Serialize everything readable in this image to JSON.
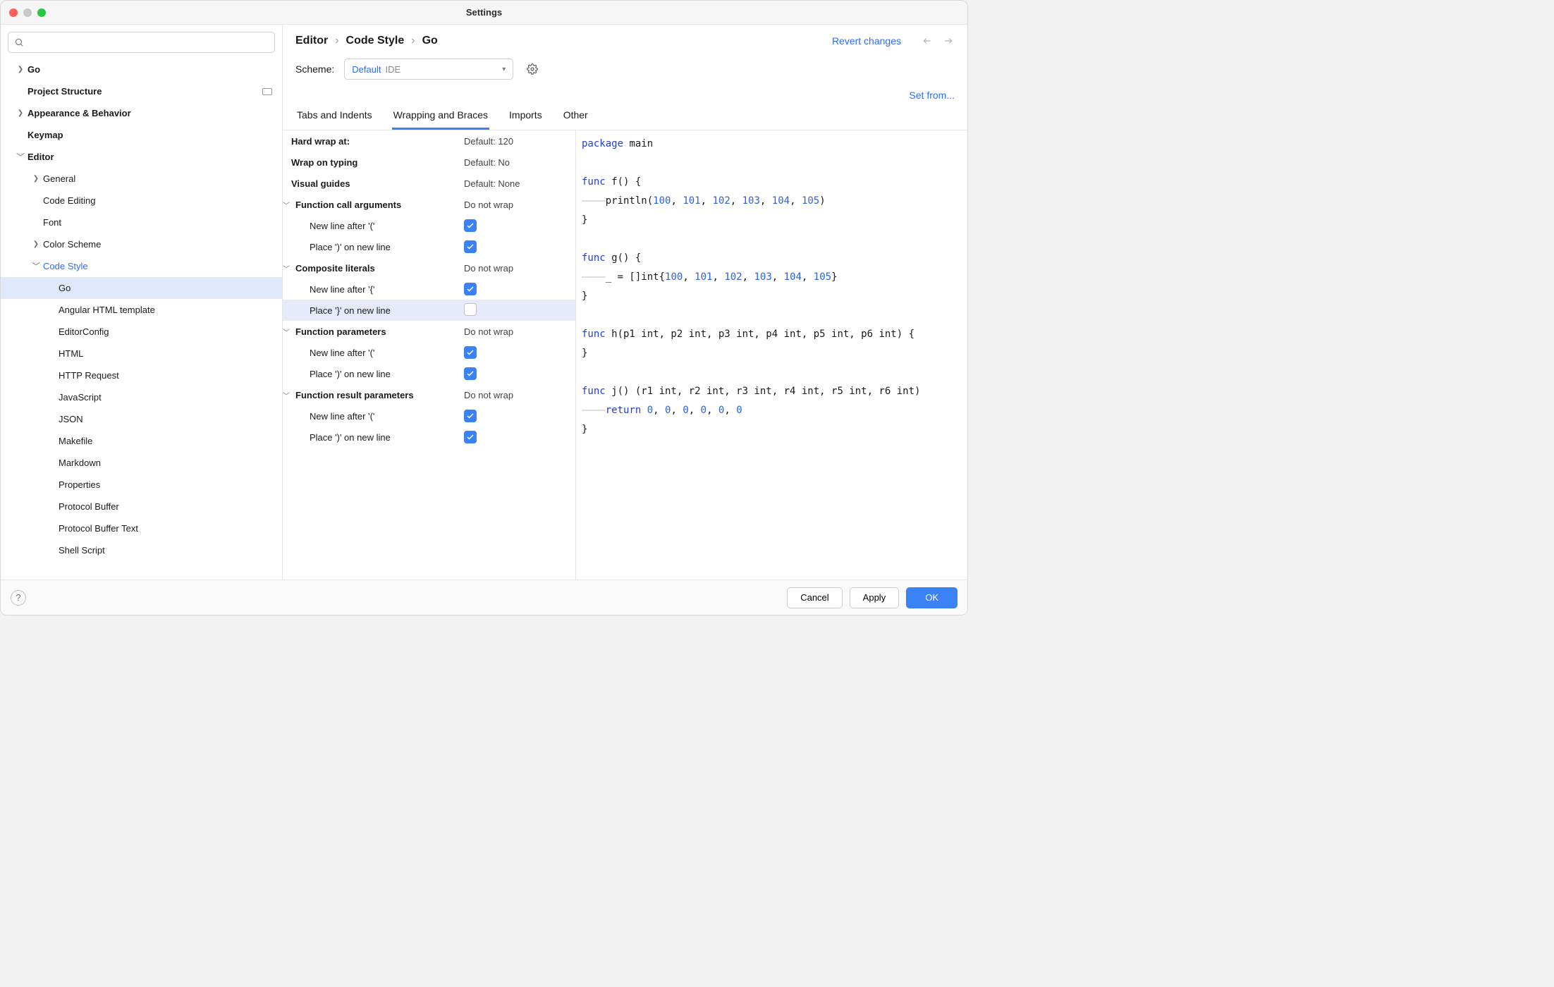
{
  "window": {
    "title": "Settings"
  },
  "sidebar": {
    "search_placeholder": "",
    "items": [
      {
        "label": "Go",
        "bold": true,
        "indent": 0,
        "arrow": "right"
      },
      {
        "label": "Project Structure",
        "bold": true,
        "indent": 0,
        "arrow": "",
        "panelIcon": true
      },
      {
        "label": "Appearance & Behavior",
        "bold": true,
        "indent": 0,
        "arrow": "right"
      },
      {
        "label": "Keymap",
        "bold": true,
        "indent": 0,
        "arrow": ""
      },
      {
        "label": "Editor",
        "bold": true,
        "indent": 0,
        "arrow": "down"
      },
      {
        "label": "General",
        "bold": false,
        "indent": 1,
        "arrow": "right"
      },
      {
        "label": "Code Editing",
        "bold": false,
        "indent": 1,
        "arrow": ""
      },
      {
        "label": "Font",
        "bold": false,
        "indent": 1,
        "arrow": ""
      },
      {
        "label": "Color Scheme",
        "bold": false,
        "indent": 1,
        "arrow": "right"
      },
      {
        "label": "Code Style",
        "bold": false,
        "indent": 1,
        "arrow": "down",
        "active": true
      },
      {
        "label": "Go",
        "bold": false,
        "indent": 2,
        "arrow": "",
        "selected": true
      },
      {
        "label": "Angular HTML template",
        "bold": false,
        "indent": 2,
        "arrow": ""
      },
      {
        "label": "EditorConfig",
        "bold": false,
        "indent": 2,
        "arrow": ""
      },
      {
        "label": "HTML",
        "bold": false,
        "indent": 2,
        "arrow": ""
      },
      {
        "label": "HTTP Request",
        "bold": false,
        "indent": 2,
        "arrow": ""
      },
      {
        "label": "JavaScript",
        "bold": false,
        "indent": 2,
        "arrow": ""
      },
      {
        "label": "JSON",
        "bold": false,
        "indent": 2,
        "arrow": ""
      },
      {
        "label": "Makefile",
        "bold": false,
        "indent": 2,
        "arrow": ""
      },
      {
        "label": "Markdown",
        "bold": false,
        "indent": 2,
        "arrow": ""
      },
      {
        "label": "Properties",
        "bold": false,
        "indent": 2,
        "arrow": ""
      },
      {
        "label": "Protocol Buffer",
        "bold": false,
        "indent": 2,
        "arrow": ""
      },
      {
        "label": "Protocol Buffer Text",
        "bold": false,
        "indent": 2,
        "arrow": ""
      },
      {
        "label": "Shell Script",
        "bold": false,
        "indent": 2,
        "arrow": ""
      }
    ]
  },
  "breadcrumb": [
    "Editor",
    "Code Style",
    "Go"
  ],
  "revertLabel": "Revert changes",
  "scheme": {
    "label": "Scheme:",
    "value": "Default",
    "scope": "IDE"
  },
  "setFrom": "Set from...",
  "tabs": [
    {
      "label": "Tabs and Indents",
      "active": false
    },
    {
      "label": "Wrapping and Braces",
      "active": true
    },
    {
      "label": "Imports",
      "active": false
    },
    {
      "label": "Other",
      "active": false
    }
  ],
  "settings": [
    {
      "type": "plain",
      "bold": true,
      "name": "Hard wrap at:",
      "val": "Default: 120"
    },
    {
      "type": "plain",
      "bold": true,
      "name": "Wrap on typing",
      "val": "Default: No"
    },
    {
      "type": "plain",
      "bold": true,
      "name": "Visual guides",
      "val": "Default: None"
    },
    {
      "type": "group",
      "bold": true,
      "name": "Function call arguments",
      "val": "Do not wrap"
    },
    {
      "type": "check",
      "sub": true,
      "name": "New line after '('",
      "checked": true
    },
    {
      "type": "check",
      "sub": true,
      "name": "Place ')' on new line",
      "checked": true
    },
    {
      "type": "group",
      "bold": true,
      "name": "Composite literals",
      "val": "Do not wrap"
    },
    {
      "type": "check",
      "sub": true,
      "name": "New line after '{'",
      "checked": true
    },
    {
      "type": "check",
      "sub": true,
      "name": "Place '}' on new line",
      "checked": false,
      "selected": true
    },
    {
      "type": "group",
      "bold": true,
      "name": "Function parameters",
      "val": "Do not wrap"
    },
    {
      "type": "check",
      "sub": true,
      "name": "New line after '('",
      "checked": true
    },
    {
      "type": "check",
      "sub": true,
      "name": "Place ')' on new line",
      "checked": true
    },
    {
      "type": "group",
      "bold": true,
      "name": "Function result parameters",
      "val": "Do not wrap"
    },
    {
      "type": "check",
      "sub": true,
      "name": "New line after '('",
      "checked": true
    },
    {
      "type": "check",
      "sub": true,
      "name": "Place ')' on new line",
      "checked": true
    }
  ],
  "preview": {
    "lines": [
      {
        "type": "kwline",
        "parts": [
          [
            "kw",
            "package"
          ],
          [
            "txt",
            " main"
          ]
        ]
      },
      {
        "type": "blank"
      },
      {
        "type": "kwline",
        "parts": [
          [
            "kw",
            "func"
          ],
          [
            "txt",
            " f() {"
          ]
        ]
      },
      {
        "type": "indented",
        "parts": [
          [
            "txt",
            "println("
          ],
          [
            "num",
            "100"
          ],
          [
            "txt",
            ", "
          ],
          [
            "num",
            "101"
          ],
          [
            "txt",
            ", "
          ],
          [
            "num",
            "102"
          ],
          [
            "txt",
            ", "
          ],
          [
            "num",
            "103"
          ],
          [
            "txt",
            ", "
          ],
          [
            "num",
            "104"
          ],
          [
            "txt",
            ", "
          ],
          [
            "num",
            "105"
          ],
          [
            "txt",
            ")"
          ]
        ]
      },
      {
        "type": "plain",
        "parts": [
          [
            "txt",
            "}"
          ]
        ]
      },
      {
        "type": "blank"
      },
      {
        "type": "kwline",
        "parts": [
          [
            "kw",
            "func"
          ],
          [
            "txt",
            " g() {"
          ]
        ]
      },
      {
        "type": "indented",
        "parts": [
          [
            "txt",
            "_ = []int{"
          ],
          [
            "num",
            "100"
          ],
          [
            "txt",
            ", "
          ],
          [
            "num",
            "101"
          ],
          [
            "txt",
            ", "
          ],
          [
            "num",
            "102"
          ],
          [
            "txt",
            ", "
          ],
          [
            "num",
            "103"
          ],
          [
            "txt",
            ", "
          ],
          [
            "num",
            "104"
          ],
          [
            "txt",
            ", "
          ],
          [
            "num",
            "105"
          ],
          [
            "txt",
            "}"
          ]
        ]
      },
      {
        "type": "plain",
        "parts": [
          [
            "txt",
            "}"
          ]
        ]
      },
      {
        "type": "blank"
      },
      {
        "type": "kwline",
        "parts": [
          [
            "kw",
            "func"
          ],
          [
            "txt",
            " h(p1 int, p2 int, p3 int, p4 int, p5 int, p6 int) {"
          ]
        ]
      },
      {
        "type": "plain",
        "parts": [
          [
            "txt",
            "}"
          ]
        ]
      },
      {
        "type": "blank"
      },
      {
        "type": "kwline",
        "parts": [
          [
            "kw",
            "func"
          ],
          [
            "txt",
            " j() (r1 int, r2 int, r3 int, r4 int, r5 int, r6 int) "
          ]
        ]
      },
      {
        "type": "indented",
        "parts": [
          [
            "kw",
            "return"
          ],
          [
            "txt",
            " "
          ],
          [
            "num",
            "0"
          ],
          [
            "txt",
            ", "
          ],
          [
            "num",
            "0"
          ],
          [
            "txt",
            ", "
          ],
          [
            "num",
            "0"
          ],
          [
            "txt",
            ", "
          ],
          [
            "num",
            "0"
          ],
          [
            "txt",
            ", "
          ],
          [
            "num",
            "0"
          ],
          [
            "txt",
            ", "
          ],
          [
            "num",
            "0"
          ]
        ]
      },
      {
        "type": "plain",
        "parts": [
          [
            "txt",
            "}"
          ]
        ]
      }
    ]
  },
  "footer": {
    "cancel": "Cancel",
    "apply": "Apply",
    "ok": "OK"
  }
}
